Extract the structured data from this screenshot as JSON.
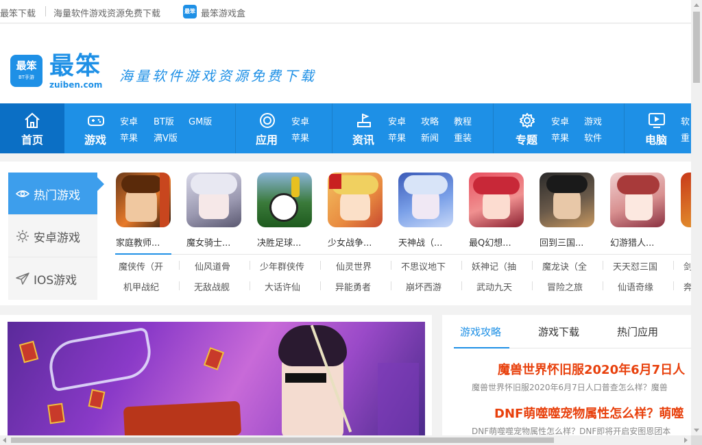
{
  "topbar": {
    "site": "最笨下载",
    "tagline": "海量软件游戏资源免费下载",
    "box_icon": "最笨",
    "box": "最笨游戏盒"
  },
  "header": {
    "logo_badge": "最笨",
    "logo_badge_sub": "BT手游",
    "logo_word": "最笨",
    "logo_domain": "zuiben.com",
    "slogan": "海量软件游戏资源免费下载"
  },
  "nav": {
    "home": "首页",
    "game": {
      "label": "游戏",
      "subs": [
        "安卓",
        "BT版",
        "GM版",
        "苹果",
        "满V版"
      ]
    },
    "app": {
      "label": "应用",
      "subs": [
        "安卓",
        "苹果"
      ]
    },
    "news": {
      "label": "资讯",
      "subs": [
        "安卓",
        "攻略",
        "教程",
        "苹果",
        "新闻",
        "重装"
      ]
    },
    "topic": {
      "label": "专题",
      "subs": [
        "安卓",
        "游戏",
        "苹果",
        "软件"
      ]
    },
    "pc": {
      "label": "电脑",
      "subs": [
        "软",
        "重"
      ]
    }
  },
  "hot": {
    "tabs": [
      "热门游戏",
      "安卓游戏",
      "IOS游戏"
    ],
    "games": [
      "家庭教师...",
      "魔女骑士...",
      "决胜足球...",
      "少女战争...",
      "天神战（...",
      "最Q幻想...",
      "回到三国...",
      "幻游猎人...",
      ""
    ],
    "text_row1": [
      "魔侠传（开",
      "仙风道骨",
      "少年群侠传",
      "仙灵世界",
      "不思议地下",
      "妖神记（抽",
      "魔龙诀（全",
      "天天怼三国",
      "剑"
    ],
    "text_row2": [
      "机甲战纪",
      "无敌战舰",
      "大话许仙",
      "异能勇者",
      "崩坏西游",
      "武动九天",
      "冒险之旅",
      "仙语奇缘",
      "奔"
    ]
  },
  "news": {
    "tabs": [
      "游戏攻略",
      "游戏下载",
      "热门应用"
    ],
    "items": [
      {
        "title": "魔兽世界怀旧服2020年6月7日人",
        "desc": "魔兽世界怀旧服2020年6月7日人口普查怎么样？魔兽"
      },
      {
        "title": "DNF萌噬噬宠物属性怎么样？萌噬",
        "desc": "DNF萌噬噬宠物属性怎么样？DNF即将开启安图恩团本"
      }
    ]
  },
  "colors": {
    "brand": "#1e90e6",
    "nav_dark": "#0b6fc5",
    "headline": "#e8400c"
  }
}
